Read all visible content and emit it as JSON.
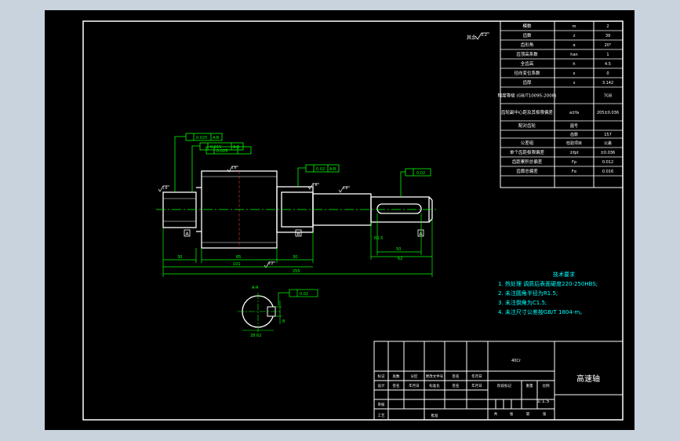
{
  "title_block": {
    "drawing_title": "高速轴",
    "material_note": "40Cr",
    "scale": "1:1.5",
    "rows": [
      [
        "标记",
        "处数",
        "分区",
        "更改文件号",
        "签名",
        "年月日"
      ],
      [
        "设计",
        "签名",
        "年月日",
        "标准化",
        "签名",
        "年月日",
        "阶段标记",
        "重量",
        "比例"
      ],
      [
        "审核"
      ],
      [
        "工艺",
        "批准"
      ]
    ],
    "sheet_labels": [
      "共",
      "张",
      "第",
      "张"
    ]
  },
  "params_table": {
    "rows": [
      [
        "模数",
        "m",
        "2"
      ],
      [
        "齿数",
        "z",
        "39"
      ],
      [
        "齿形角",
        "α",
        "20°"
      ],
      [
        "齿顶高系数",
        "han",
        "1"
      ],
      [
        "全齿高",
        "h",
        "4.5"
      ],
      [
        "径向变位系数",
        "x",
        "0"
      ],
      [
        "齿厚",
        "s",
        "3.142"
      ],
      [
        "精度等级 (GB/T10095-2008)",
        "",
        "7GB"
      ],
      [
        "齿轮副中心距及其极限偏差",
        "a±fa",
        "205±0.036"
      ],
      [
        "配对齿轮",
        "图号",
        ""
      ],
      [
        "",
        "齿数",
        "157"
      ],
      [
        "公差组",
        "检验项目",
        "公差"
      ],
      [
        "单个齿距极限偏差",
        "±fpt",
        "±0.036"
      ],
      [
        "齿距累积总偏差",
        "Fp",
        "0.012"
      ],
      [
        "齿廓总偏差",
        "Fα",
        "0.016"
      ]
    ]
  },
  "tech_requirements": {
    "heading": "技术要求",
    "items": [
      "1. 热处理 调质后表面硬度220-250HBS;",
      "2. 未注圆角半径为R1.5;",
      "3. 未注倒角为C1.5;",
      "4. 未注尺寸公差按GB/T 1804-m。"
    ]
  },
  "annotations": {
    "roughness_general": "其余",
    "roughness_value": "3.2",
    "ra_small": "1.6",
    "tolerance_1": "0.025",
    "tolerance_2": "0.02",
    "tolerance_3": "0.015",
    "datum_ae": "A-B",
    "dim_30": "30",
    "dim_85": "85",
    "dim_101": "101",
    "dim_255": "255",
    "dim_50": "50",
    "dim_62": "62",
    "dim_r15": "R1.5",
    "section_label": "A-A",
    "section_dim_1": "28.62",
    "section_dim_2": "8",
    "datum_a": "A",
    "datum_b": "B"
  },
  "colors": {
    "background": "#000000",
    "frame": "#ffffff",
    "dimension": "#00ff00",
    "table": "#ffffff",
    "annotation": "#00ffff",
    "viewport": "#c9d3de"
  }
}
